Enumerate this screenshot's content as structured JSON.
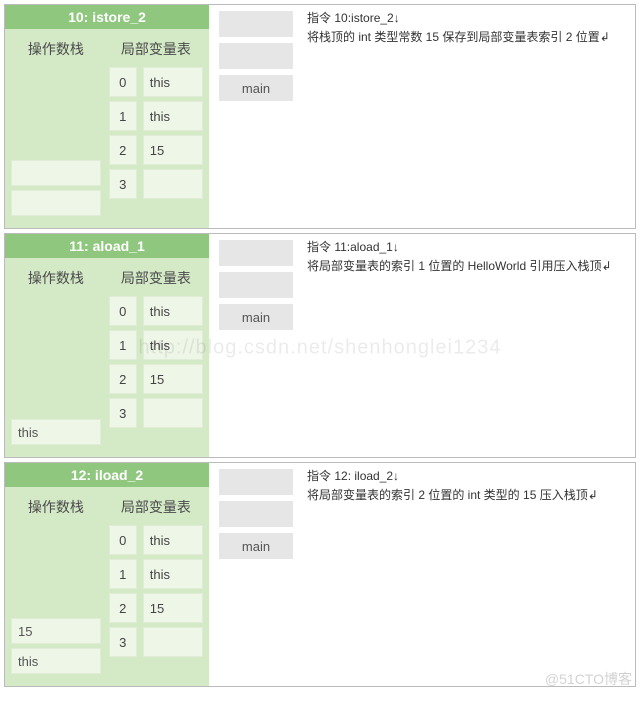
{
  "labels": {
    "operand_stack": "操作数栈",
    "local_vars": "局部变量表",
    "call_frame": "main",
    "cmd_prefix": "指令 "
  },
  "rows": [
    {
      "title": "10: istore_2",
      "cmd": "10:istore_2↓",
      "desc": "将栈顶的 int 类型常数 15 保存到局部变量表索引 2 位置↲",
      "operand": [
        "",
        ""
      ],
      "locals": [
        {
          "idx": "0",
          "val": "this"
        },
        {
          "idx": "1",
          "val": "this"
        },
        {
          "idx": "2",
          "val": "15"
        },
        {
          "idx": "3",
          "val": ""
        }
      ]
    },
    {
      "title": "11: aload_1",
      "cmd": "11:aload_1↓",
      "desc": "将局部变量表的索引 1 位置的 HelloWorld 引用压入栈顶↲",
      "operand": [
        "this"
      ],
      "locals": [
        {
          "idx": "0",
          "val": "this"
        },
        {
          "idx": "1",
          "val": "this"
        },
        {
          "idx": "2",
          "val": "15"
        },
        {
          "idx": "3",
          "val": ""
        }
      ]
    },
    {
      "title": "12: iload_2",
      "cmd": "12: iload_2↓",
      "desc": "将局部变量表的索引 2 位置的 int 类型的 15 压入栈顶↲",
      "operand": [
        "this",
        "15"
      ],
      "locals": [
        {
          "idx": "0",
          "val": "this"
        },
        {
          "idx": "1",
          "val": "this"
        },
        {
          "idx": "2",
          "val": "15"
        },
        {
          "idx": "3",
          "val": ""
        }
      ]
    }
  ],
  "watermarks": {
    "center": "http://blog.csdn.net/shenhonglei1234",
    "corner": "@51CTO博客"
  }
}
